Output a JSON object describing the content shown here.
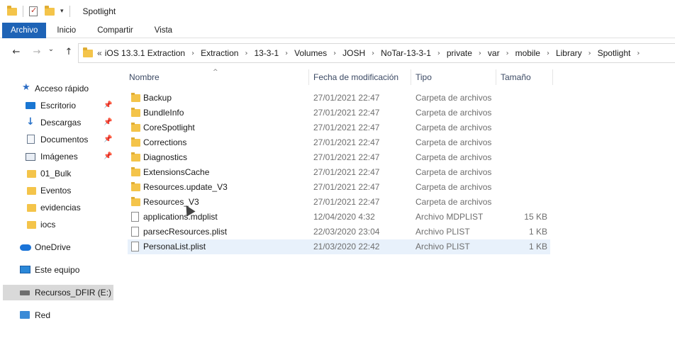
{
  "window": {
    "title": "Spotlight"
  },
  "quick_access_toolbar": {
    "icons": [
      "folder-icon",
      "properties-icon",
      "new-folder-icon",
      "customize-dropdown-icon"
    ],
    "dropdown_glyph": "▾"
  },
  "ribbon": {
    "tabs": [
      "Archivo",
      "Inicio",
      "Compartir",
      "Vista"
    ],
    "file_tab_color": "#1e63b6"
  },
  "navigation": {
    "back_glyph": "←",
    "forward_glyph": "→",
    "dropdown_glyph": "⌄",
    "up_glyph": "↑",
    "overflow_glyph": "«",
    "separator_glyph": "›",
    "breadcrumbs": [
      "iOS 13.3.1 Extraction",
      "Extraction",
      "13-3-1",
      "Volumes",
      "JOSH",
      "NoTar-13-3-1",
      "private",
      "var",
      "mobile",
      "Library",
      "Spotlight"
    ]
  },
  "sidebar": {
    "pin_glyph": "📌",
    "items": [
      {
        "label": "Acceso rápido",
        "icon": "star-icon",
        "pinned": false
      },
      {
        "label": "Escritorio",
        "icon": "desktop-icon",
        "pinned": true
      },
      {
        "label": "Descargas",
        "icon": "download-icon",
        "pinned": true
      },
      {
        "label": "Documentos",
        "icon": "documents-icon",
        "pinned": true
      },
      {
        "label": "Imágenes",
        "icon": "pictures-icon",
        "pinned": true
      },
      {
        "label": "01_Bulk",
        "icon": "folder-icon",
        "pinned": false
      },
      {
        "label": "Eventos",
        "icon": "folder-icon",
        "pinned": false
      },
      {
        "label": "evidencias",
        "icon": "folder-icon",
        "pinned": false
      },
      {
        "label": "iocs",
        "icon": "folder-icon",
        "pinned": false
      },
      {
        "label": "OneDrive",
        "icon": "onedrive-cloud-icon",
        "pinned": false
      },
      {
        "label": "Este equipo",
        "icon": "this-pc-icon",
        "pinned": false
      },
      {
        "label": "Recursos_DFIR (E:)",
        "icon": "drive-icon",
        "pinned": false,
        "selected": true
      },
      {
        "label": "Red",
        "icon": "network-icon",
        "pinned": false
      }
    ]
  },
  "file_list": {
    "sort_glyph": "^",
    "columns": [
      "Nombre",
      "Fecha de modificación",
      "Tipo",
      "Tamaño"
    ],
    "rows": [
      {
        "name": "Backup",
        "date": "27/01/2021 22:47",
        "type": "Carpeta de archivos",
        "size": "",
        "kind": "folder"
      },
      {
        "name": "BundleInfo",
        "date": "27/01/2021 22:47",
        "type": "Carpeta de archivos",
        "size": "",
        "kind": "folder"
      },
      {
        "name": "CoreSpotlight",
        "date": "27/01/2021 22:47",
        "type": "Carpeta de archivos",
        "size": "",
        "kind": "folder"
      },
      {
        "name": "Corrections",
        "date": "27/01/2021 22:47",
        "type": "Carpeta de archivos",
        "size": "",
        "kind": "folder"
      },
      {
        "name": "Diagnostics",
        "date": "27/01/2021 22:47",
        "type": "Carpeta de archivos",
        "size": "",
        "kind": "folder"
      },
      {
        "name": "ExtensionsCache",
        "date": "27/01/2021 22:47",
        "type": "Carpeta de archivos",
        "size": "",
        "kind": "folder"
      },
      {
        "name": "Resources.update_V3",
        "date": "27/01/2021 22:47",
        "type": "Carpeta de archivos",
        "size": "",
        "kind": "folder"
      },
      {
        "name": "Resources_V3",
        "date": "27/01/2021 22:47",
        "type": "Carpeta de archivos",
        "size": "",
        "kind": "folder"
      },
      {
        "name": "applications.mdplist",
        "date": "12/04/2020 4:32",
        "type": "Archivo MDPLIST",
        "size": "15 KB",
        "kind": "file"
      },
      {
        "name": "parsecResources.plist",
        "date": "22/03/2020 23:04",
        "type": "Archivo PLIST",
        "size": "1 KB",
        "kind": "file"
      },
      {
        "name": "PersonaList.plist",
        "date": "21/03/2020 22:42",
        "type": "Archivo PLIST",
        "size": "1 KB",
        "kind": "file",
        "highlighted": true
      }
    ]
  }
}
